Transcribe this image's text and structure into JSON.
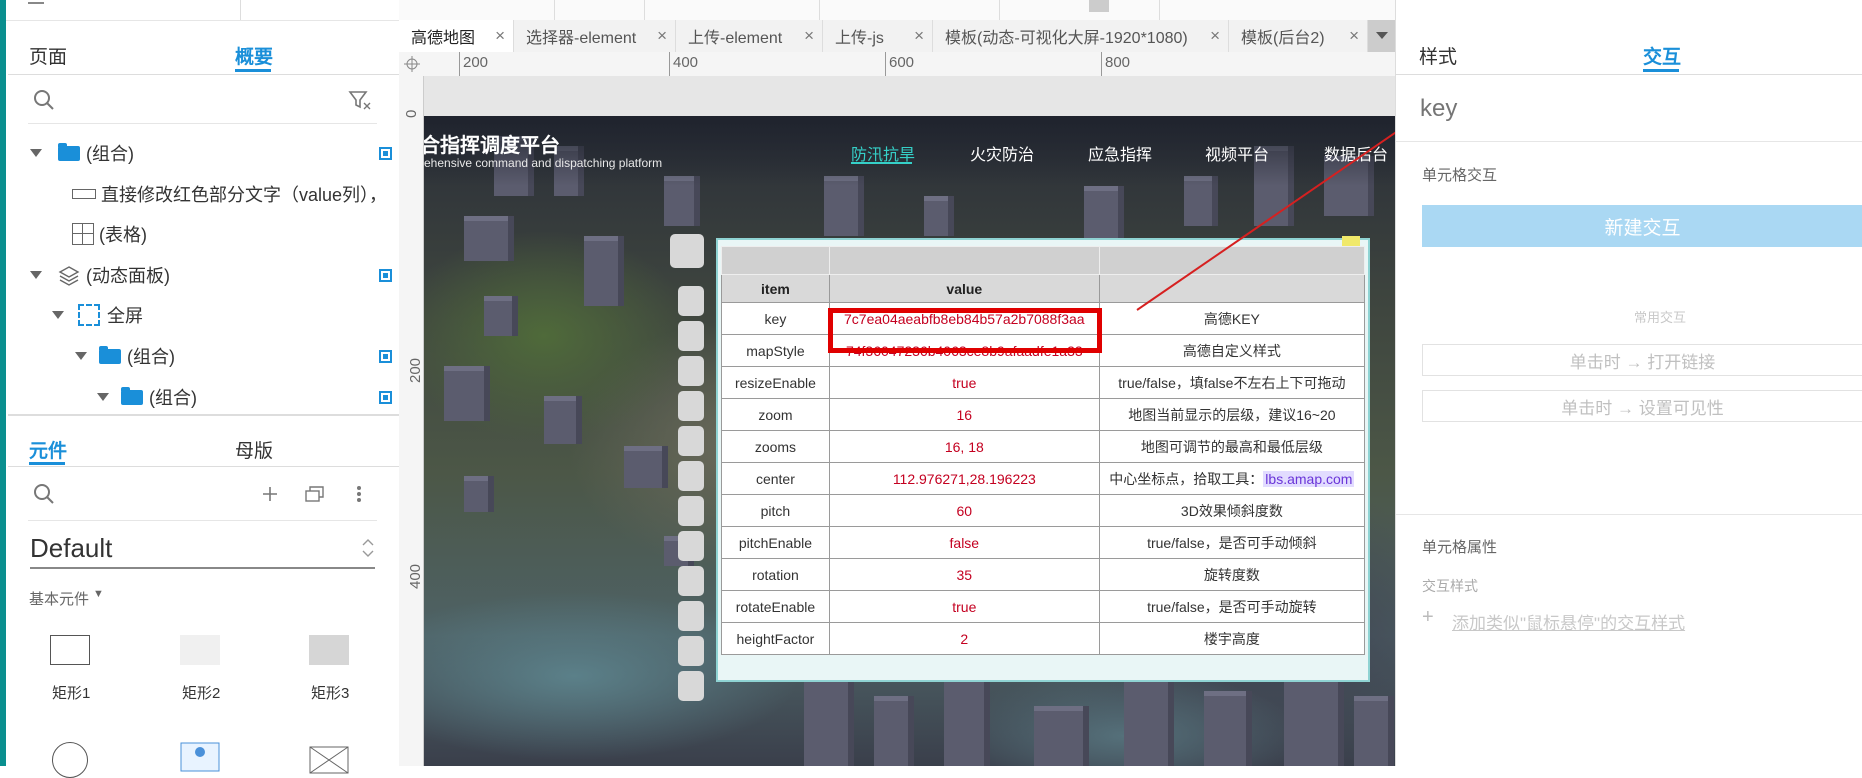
{
  "left_panel": {
    "tabs": [
      {
        "label": "页面"
      },
      {
        "label": "概要"
      }
    ],
    "outline": [
      {
        "label": "(组合)"
      },
      {
        "label": "直接修改红色部分文字（value列），"
      },
      {
        "label": "(表格)"
      },
      {
        "label": "(动态面板)"
      },
      {
        "label": "全屏"
      },
      {
        "label": "(组合)"
      },
      {
        "label": "(组合)"
      }
    ],
    "lib_tabs": [
      {
        "label": "元件"
      },
      {
        "label": "母版"
      }
    ],
    "library_select": "Default",
    "category": "基本元件",
    "widgets": [
      {
        "label": "矩形1"
      },
      {
        "label": "矩形2"
      },
      {
        "label": "矩形3"
      }
    ]
  },
  "doc_tabs": [
    {
      "label": "高德地图"
    },
    {
      "label": "选择器-element"
    },
    {
      "label": "上传-element"
    },
    {
      "label": "上传-js"
    },
    {
      "label": "模板(动态-可视化大屏-1920*1080)"
    },
    {
      "label": "模板(后台2)"
    }
  ],
  "ruler": {
    "h": [
      "200",
      "400",
      "600",
      "800"
    ],
    "v": [
      "0",
      "200",
      "400"
    ]
  },
  "dashboard": {
    "title": "合指挥调度平台",
    "subtitle": "rehensive command and dispatching platform",
    "nav": [
      "防汛抗旱",
      "火灾防治",
      "应急指挥",
      "视频平台",
      "数据后台"
    ]
  },
  "table": {
    "headers": [
      "item",
      "value",
      ""
    ],
    "rows": [
      {
        "item": "key",
        "value": "7c7ea04aeabfb8eb84b57a2b7088f3aa",
        "desc": "高德KEY"
      },
      {
        "item": "mapStyle",
        "value": "74f36047236b4063ce8b9afaadfe1a33",
        "desc": "高德自定义样式"
      },
      {
        "item": "resizeEnable",
        "value": "true",
        "desc": "true/false，填false不左右上下可拖动"
      },
      {
        "item": "zoom",
        "value": "16",
        "desc": "地图当前显示的层级，建议16~20"
      },
      {
        "item": "zooms",
        "value": "16, 18",
        "desc": "地图可调节的最高和最低层级"
      },
      {
        "item": "center",
        "value": "112.976271,28.196223",
        "desc": "中心坐标点，拾取工具：",
        "link": "lbs.amap.com"
      },
      {
        "item": "pitch",
        "value": "60",
        "desc": "3D效果倾斜度数"
      },
      {
        "item": "pitchEnable",
        "value": "false",
        "desc": "true/false，是否可手动倾斜"
      },
      {
        "item": "rotation",
        "value": "35",
        "desc": "旋转度数"
      },
      {
        "item": "rotateEnable",
        "value": "true",
        "desc": "true/false，是否可手动旋转"
      },
      {
        "item": "heightFactor",
        "value": "2",
        "desc": "楼宇高度"
      }
    ]
  },
  "right_panel": {
    "tabs": [
      {
        "label": "样式"
      },
      {
        "label": "交互"
      }
    ],
    "name_placeholder": "key",
    "cell_interaction": "单元格交互",
    "new_interaction": "新建交互",
    "common": "常用交互",
    "common_items": [
      "单击时 → 打开链接",
      "单击时 → 设置可见性"
    ],
    "cell_props": "单元格属性",
    "interaction_style": "交互样式",
    "add_style": "添加类似\"鼠标悬停\"的交互样式"
  },
  "colors": {
    "accent": "#1a8fd9",
    "value_red": "#c40020",
    "highlight_box": "#e00000",
    "arrow": "#d62020",
    "teal_nav": "#35d0c8"
  }
}
